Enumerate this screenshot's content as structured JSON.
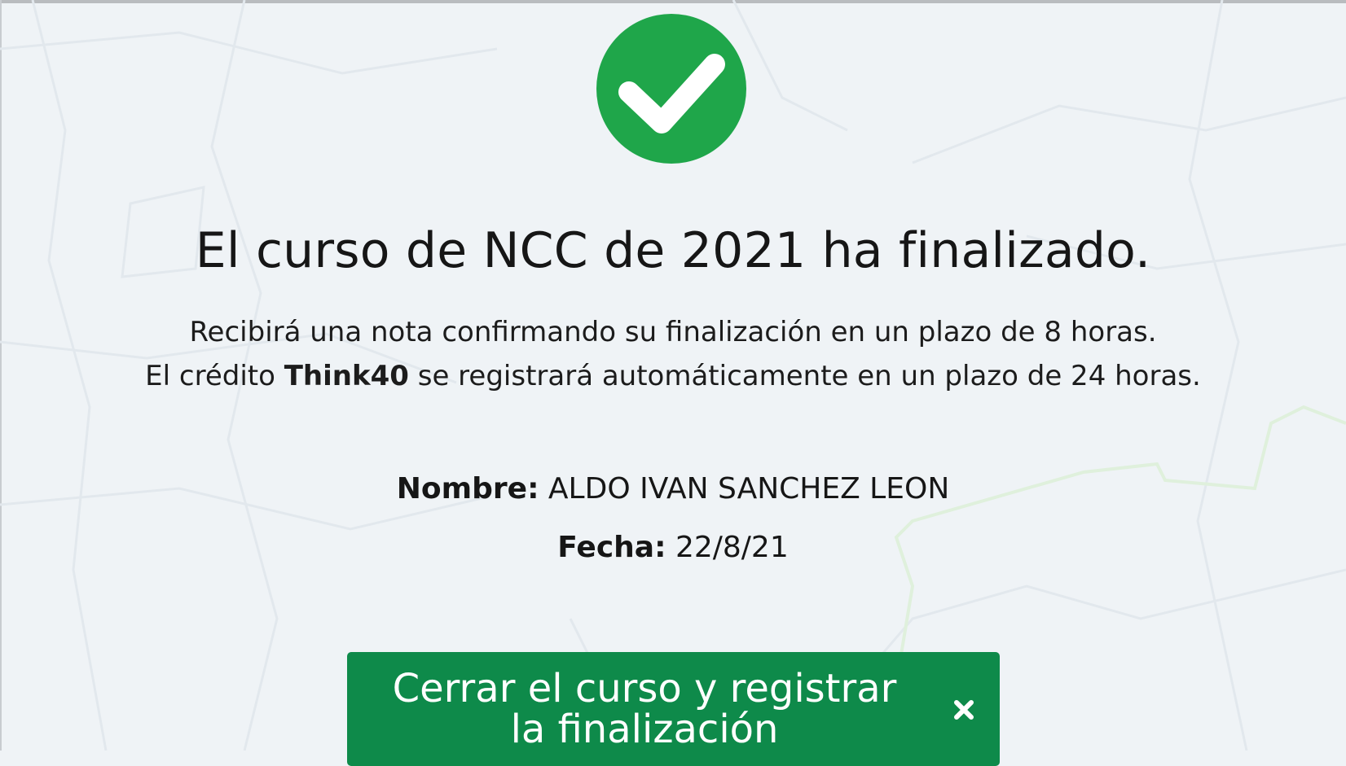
{
  "status": {
    "icon": "check-circle-icon",
    "icon_color": "#1fa64a",
    "check_color": "#ffffff"
  },
  "completion": {
    "title": "El curso de NCC de 2021 ha finalizado.",
    "line1": "Recibirá una nota confirmando su finalización en un plazo de 8 horas.",
    "line2_prefix": "El crédito",
    "line2_brand": "Think40",
    "line2_suffix": "se registrará automáticamente en un plazo de 24 horas."
  },
  "details": {
    "name_label": "Nombre:",
    "name_value": "ALDO IVAN SANCHEZ LEON",
    "date_label": "Fecha:",
    "date_value": "22/8/21"
  },
  "actions": {
    "close_label": "Cerrar el curso y registrar la finalización",
    "close_icon": "close-icon",
    "button_color": "#0e8a4a"
  },
  "background": {
    "map_color": "#e3e9ee",
    "route_color": "#e2f1e0"
  }
}
